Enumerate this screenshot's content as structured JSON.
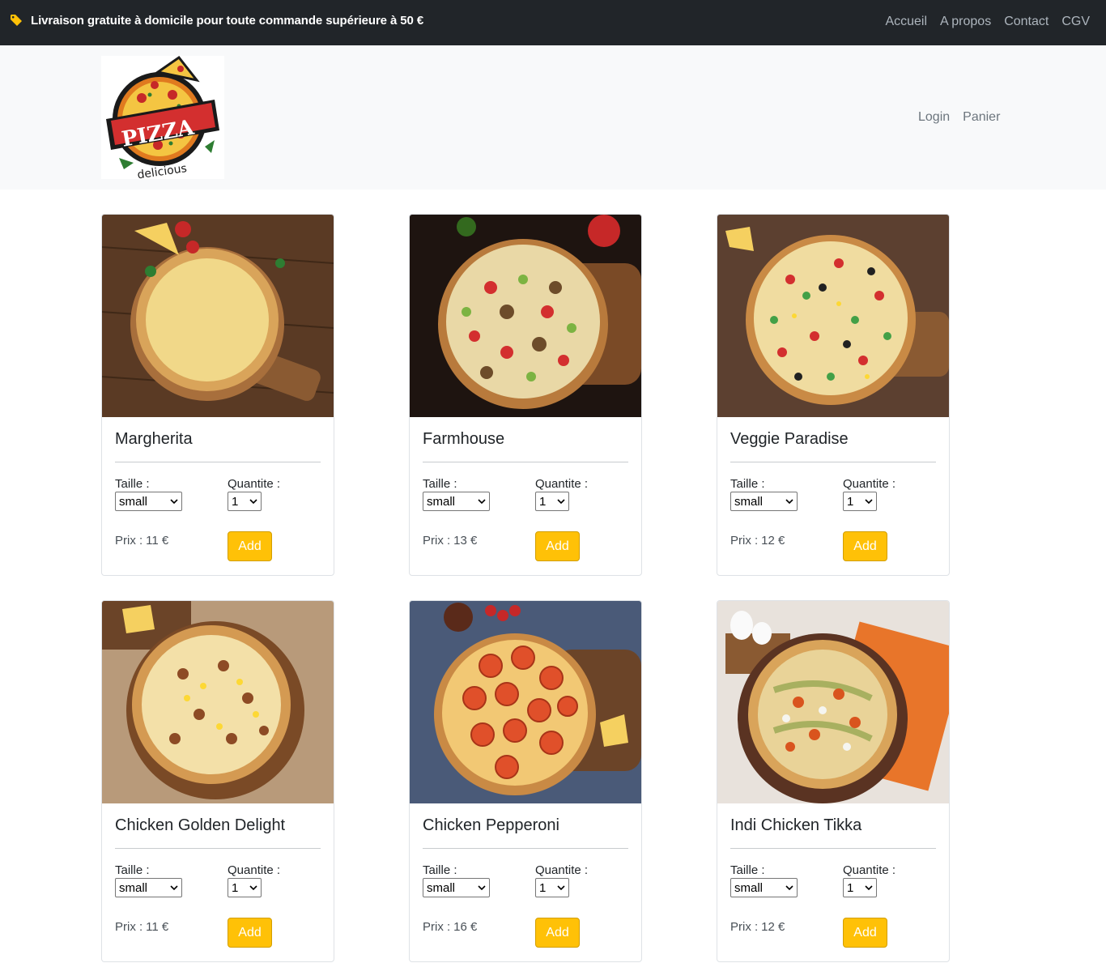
{
  "topbar": {
    "promo_text": "Livraison gratuite à domicile pour toute commande supérieure à 50 €",
    "promo_icon": "tag-icon",
    "links": [
      "Accueil",
      "A propos",
      "Contact",
      "CGV"
    ]
  },
  "header": {
    "logo_word": "PIZZA",
    "logo_sub": "delicious",
    "user_links": [
      "Login",
      "Panier"
    ]
  },
  "card_labels": {
    "size": "Taille :",
    "qty": "Quantite :",
    "price": "Prix :",
    "add": "Add"
  },
  "products": [
    {
      "name": "Margherita",
      "size": "small",
      "qty": "1",
      "price": "11 €"
    },
    {
      "name": "Farmhouse",
      "size": "small",
      "qty": "1",
      "price": "13 €"
    },
    {
      "name": "Veggie Paradise",
      "size": "small",
      "qty": "1",
      "price": "12 €"
    },
    {
      "name": "Chicken Golden Delight",
      "size": "small",
      "qty": "1",
      "price": "11 €"
    },
    {
      "name": "Chicken Pepperoni",
      "size": "small",
      "qty": "1",
      "price": "16 €"
    },
    {
      "name": "Indi Chicken Tikka",
      "size": "small",
      "qty": "1",
      "price": "12 €"
    }
  ],
  "colors": {
    "topbar_bg": "#212529",
    "header_bg": "#f8f9fa",
    "add_button": "#ffc107",
    "tag_icon": "#ffc107"
  }
}
